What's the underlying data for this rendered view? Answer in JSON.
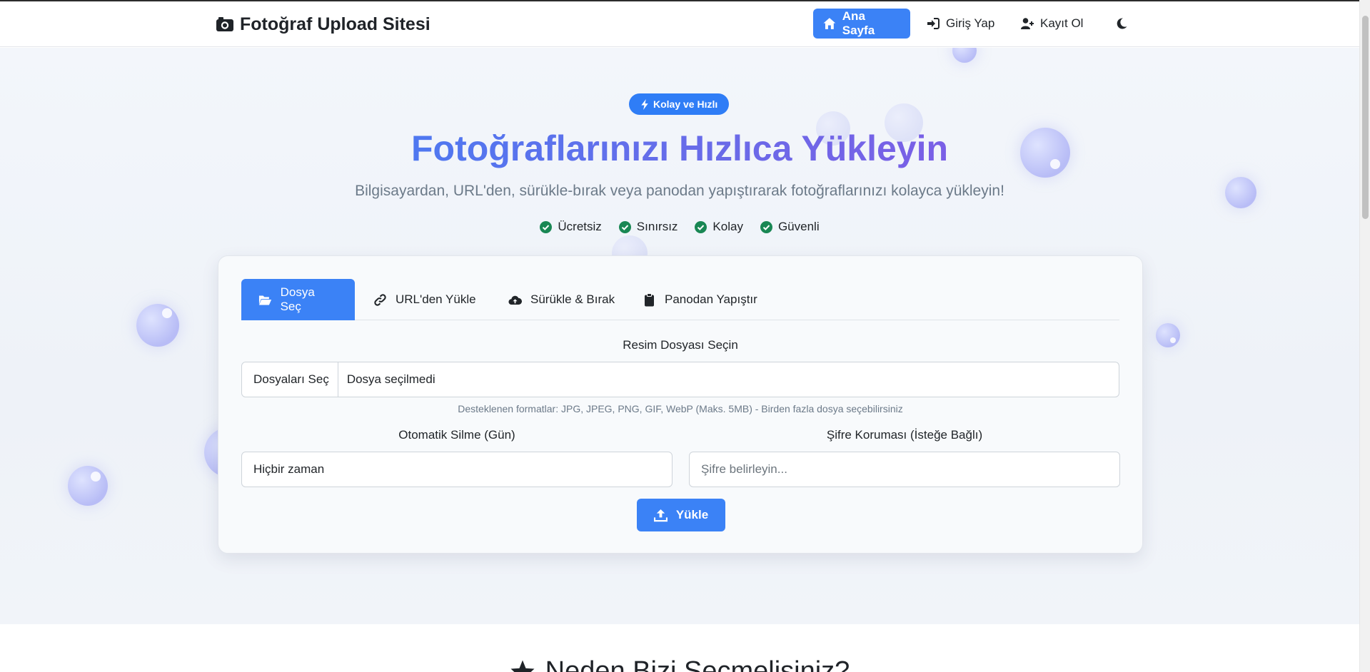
{
  "navbar": {
    "brand": "Fotoğraf Upload Sitesi",
    "links": {
      "home": "Ana Sayfa",
      "login": "Giriş Yap",
      "register": "Kayıt Ol"
    }
  },
  "hero": {
    "badge": "Kolay ve Hızlı",
    "title": "Fotoğraflarınızı Hızlıca Yükleyin",
    "subtitle": "Bilgisayardan, URL'den, sürükle-bırak veya panodan yapıştırarak fotoğraflarınızı kolayca yükleyin!",
    "features": [
      "Ücretsiz",
      "Sınırsız",
      "Kolay",
      "Güvenli"
    ]
  },
  "upload": {
    "tabs": {
      "file": "Dosya Seç",
      "url": "URL'den Yükle",
      "drag": "Sürükle & Bırak",
      "paste": "Panodan Yapıştır"
    },
    "file_label": "Resim Dosyası Seçin",
    "file_button": "Dosyaları Seç",
    "file_status": "Dosya seçilmedi",
    "hint": "Desteklenen formatlar: JPG, JPEG, PNG, GIF, WebP (Maks. 5MB) - Birden fazla dosya seçebilirsiniz",
    "auto_delete_label": "Otomatik Silme (Gün)",
    "auto_delete_value": "Hiçbir zaman",
    "password_label": "Şifre Koruması (İsteğe Bağlı)",
    "password_placeholder": "Şifre belirleyin...",
    "submit": "Yükle"
  },
  "section2": {
    "title": "Neden Bizi Seçmelisiniz?"
  },
  "colors": {
    "primary": "#3b82f6",
    "badge": "#2f7df6",
    "check": "#198754",
    "title_gradient_start": "#4f78f0",
    "title_gradient_end": "#7a5fe6"
  }
}
